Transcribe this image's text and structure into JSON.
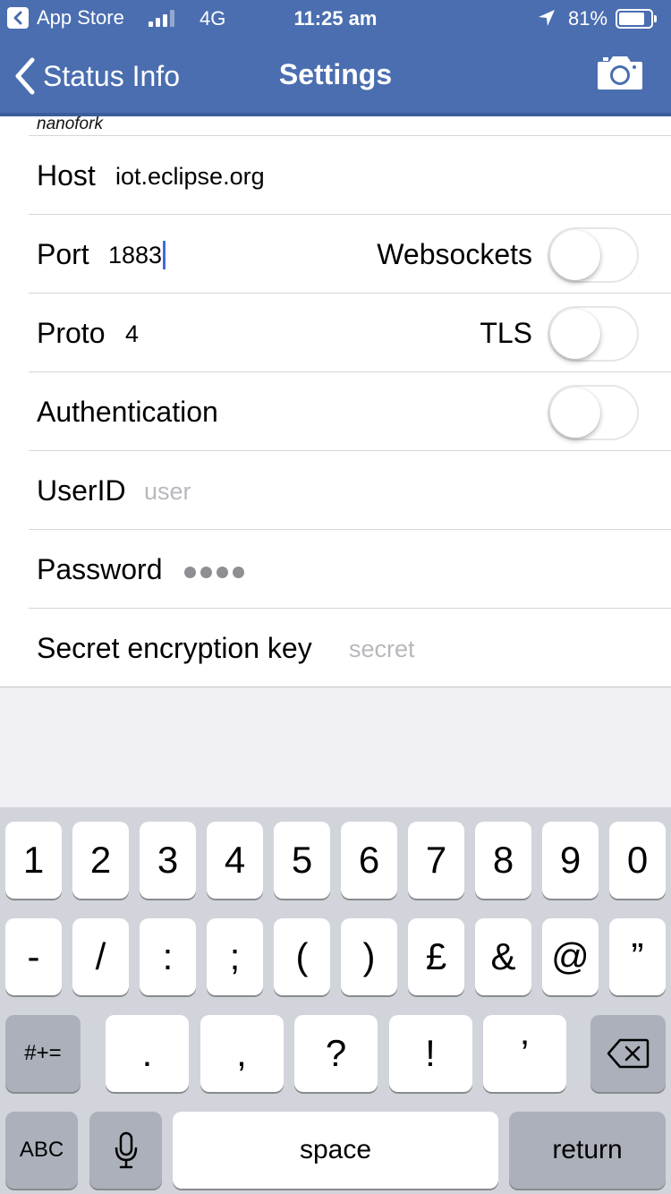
{
  "status_bar": {
    "back_app": "App Store",
    "network": "4G",
    "time": "11:25 am",
    "battery_pct": "81%",
    "battery_level": 0.81
  },
  "nav": {
    "back_label": "Status Info",
    "title": "Settings"
  },
  "section_label": "nanofork",
  "form": {
    "host_label": "Host",
    "host_value": "iot.eclipse.org",
    "port_label": "Port",
    "port_value": "1883",
    "websockets_label": "Websockets",
    "websockets_on": false,
    "proto_label": "Proto",
    "proto_value": "4",
    "tls_label": "TLS",
    "tls_on": false,
    "auth_label": "Authentication",
    "auth_on": false,
    "userid_label": "UserID",
    "userid_placeholder": "user",
    "password_label": "Password",
    "password_masked_length": 4,
    "secret_label": "Secret encryption key",
    "secret_placeholder": "secret"
  },
  "keyboard": {
    "row1": [
      "1",
      "2",
      "3",
      "4",
      "5",
      "6",
      "7",
      "8",
      "9",
      "0"
    ],
    "row2": [
      "-",
      "/",
      ":",
      ";",
      "(",
      ")",
      "£",
      "&",
      "@",
      "”"
    ],
    "row3": [
      ".",
      ",",
      "?",
      "!",
      "’"
    ],
    "symbols_label": "#+=",
    "abc_label": "ABC",
    "space_label": "space",
    "return_label": "return"
  },
  "colors": {
    "nav_bar": "#4a6eb0",
    "cursor": "#3e6be0",
    "keyboard_bg": "#d1d4da"
  }
}
